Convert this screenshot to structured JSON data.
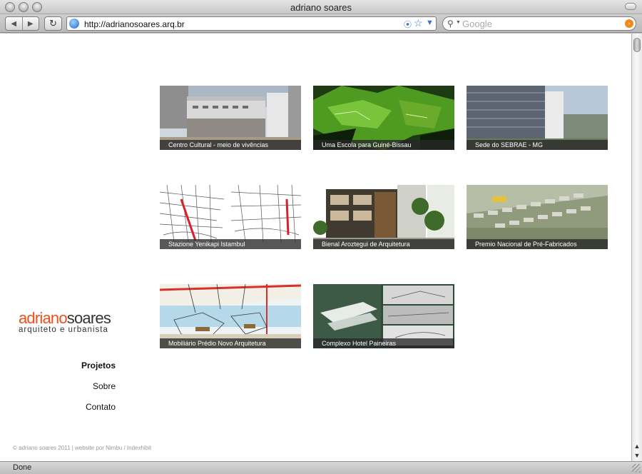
{
  "window": {
    "title": "adriano soares"
  },
  "toolbar": {
    "back_icon": "back-arrow-icon",
    "forward_icon": "forward-arrow-icon",
    "reload_icon": "reload-icon",
    "url": "http://adrianosoares.arq.br",
    "search_placeholder": "Google"
  },
  "site": {
    "logo_first": "adriano",
    "logo_last": "soares",
    "logo_sub": "arquiteto e urbanista",
    "accent_color": "#ef4d1b",
    "menu": [
      {
        "label": "Projetos",
        "active": true
      },
      {
        "label": "Sobre",
        "active": false
      },
      {
        "label": "Contato",
        "active": false
      }
    ],
    "footer": "© adriano soares 2011 | website por Nimbu / Indexhibit"
  },
  "projects": [
    {
      "caption": "Centro Cultural - meio de vivências"
    },
    {
      "caption": "Uma Escola para Guiné-Bissau"
    },
    {
      "caption": "Sede do SEBRAE - MG"
    },
    {
      "caption": "Stazione Yenikapi Istambul"
    },
    {
      "caption": "Bienal Aroztegui de Arquitetura"
    },
    {
      "caption": "Premio Nacional de Pré-Fabricados"
    },
    {
      "caption": "Mobiliário Prédio Novo Arquitetura"
    },
    {
      "caption": "Complexo Hotel Paineiras"
    }
  ],
  "status": {
    "text": "Done"
  }
}
